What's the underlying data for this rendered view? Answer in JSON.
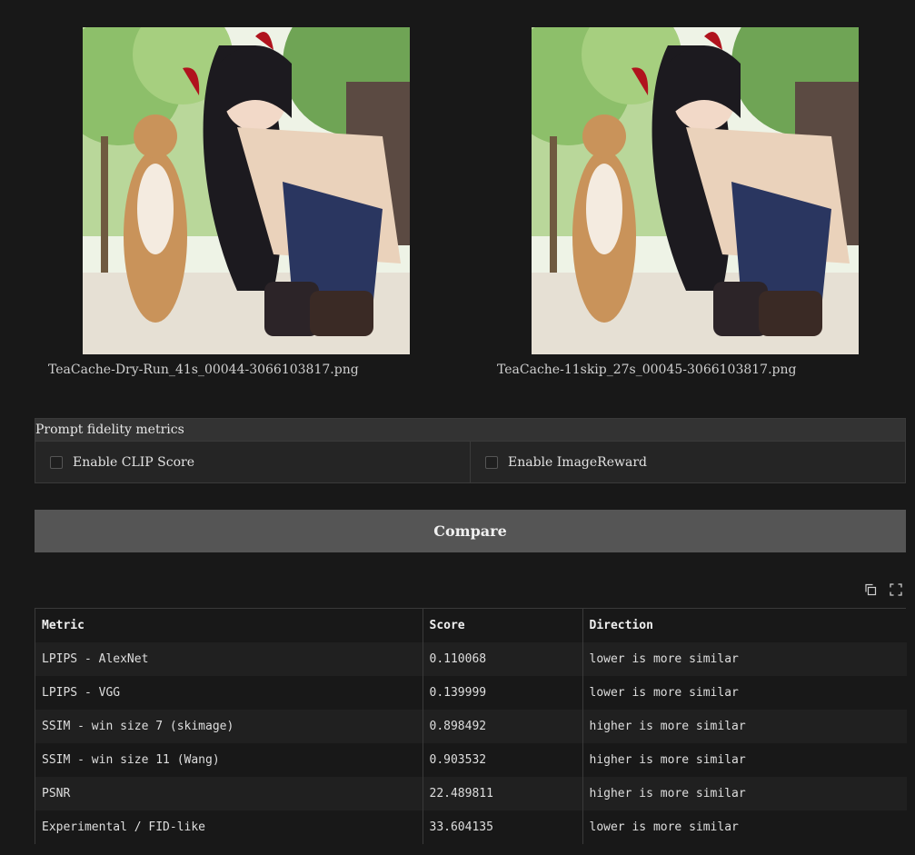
{
  "images": [
    {
      "filename": "TeaCache-Dry-Run_41s_00044-3066103817.png"
    },
    {
      "filename": "TeaCache-11skip_27s_00045-3066103817.png"
    }
  ],
  "fidelity": {
    "title": "Prompt fidelity metrics",
    "clip_label": "Enable CLIP Score",
    "clip_checked": false,
    "imagereward_label": "Enable ImageReward",
    "imagereward_checked": false
  },
  "compare_label": "Compare",
  "toolbar": {
    "copy_icon": "copy-icon",
    "fullscreen_icon": "fullscreen-icon"
  },
  "results": {
    "headers": [
      "Metric",
      "Score",
      "Direction"
    ],
    "rows": [
      [
        "LPIPS - AlexNet",
        "0.110068",
        "lower is more similar"
      ],
      [
        "LPIPS - VGG",
        "0.139999",
        "lower is more similar"
      ],
      [
        "SSIM - win size 7 (skimage)",
        "0.898492",
        "higher is more similar"
      ],
      [
        "SSIM - win size 11 (Wang)",
        "0.903532",
        "higher is more similar"
      ],
      [
        "PSNR",
        "22.489811",
        "higher is more similar"
      ],
      [
        "Experimental / FID-like",
        "33.604135",
        "lower is more similar"
      ]
    ]
  }
}
